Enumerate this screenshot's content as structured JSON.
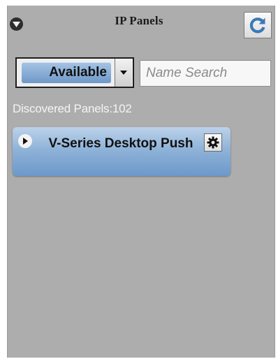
{
  "header": {
    "title": "IP Panels",
    "collapse_icon": "chevron-down-circle-icon",
    "refresh_icon": "refresh-icon"
  },
  "filter": {
    "selected": "Available",
    "dropdown_icon": "triangle-down-icon"
  },
  "search": {
    "placeholder": "Name Search",
    "value": ""
  },
  "status": {
    "discovered_text": "Discovered Panels:102"
  },
  "panels": [
    {
      "name": "V-Series Desktop Push",
      "expand_icon": "triangle-right-icon",
      "settings_icon": "gear-icon"
    }
  ],
  "colors": {
    "background": "#adadae",
    "accent_blue": "#8fb3d8",
    "refresh_blue": "#3a79b8"
  }
}
